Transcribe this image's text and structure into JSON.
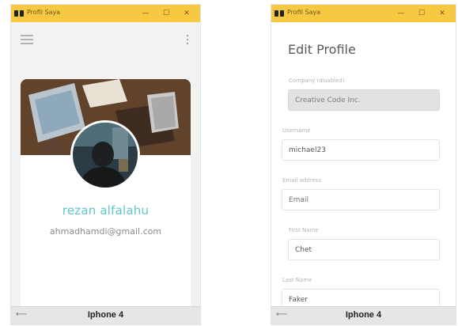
{
  "window": {
    "title": "Profil Saya"
  },
  "left_device": {
    "label": "Iphone 4",
    "profile": {
      "name": "rezan alfalahu",
      "email": "ahmadhamdi@gmail.com"
    }
  },
  "right_device": {
    "label": "Iphone 4",
    "title": "Edit Profile",
    "fields": [
      {
        "label": "Company (disabled)",
        "value": "Creative Code Inc.",
        "disabled": true
      },
      {
        "label": "Username",
        "value": "michael23"
      },
      {
        "label": "Email address",
        "value": "",
        "placeholder": "Email"
      },
      {
        "label": "First Name",
        "value": "Chet"
      },
      {
        "label": "Last Name",
        "value": "Faker"
      }
    ]
  },
  "icons": {
    "minimize": "—",
    "maximize": "☐",
    "close": "✕",
    "back": "⟵"
  },
  "colors": {
    "titlebar": "#f7c842",
    "accent_name": "#5fc6c9",
    "text_muted": "#8c8c8c",
    "statusbar": "#e6e6e6"
  }
}
